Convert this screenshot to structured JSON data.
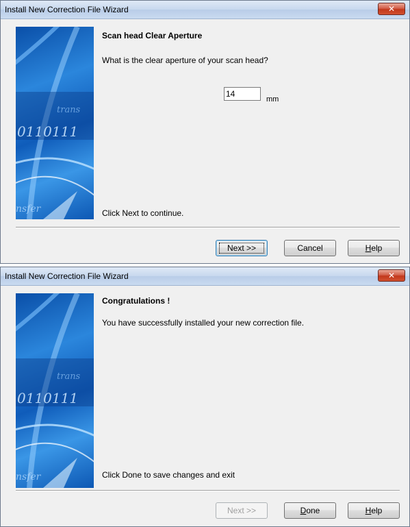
{
  "dialog1": {
    "title": "Install New Correction File Wizard",
    "close_label": "✕",
    "heading": "Scan head Clear Aperture",
    "question": "What is the clear aperture of your scan head?",
    "aperture_value": "14",
    "aperture_unit": "mm",
    "footer_text": "Click Next to continue.",
    "buttons": {
      "next": "Next >>",
      "cancel": "Cancel",
      "help_underlined": "H",
      "help_rest": "elp"
    }
  },
  "dialog2": {
    "title": "Install New Correction File Wizard",
    "close_label": "✕",
    "heading": "Congratulations !",
    "message": "You have successfully installed your new correction file.",
    "footer_text": "Click Done to save changes and exit",
    "buttons": {
      "next": "Next >>",
      "done_underlined": "D",
      "done_rest": "one",
      "help_underlined": "H",
      "help_rest": "elp"
    }
  },
  "colors": {
    "title_gradient_top": "#dfe9f6",
    "close_button": "#c2381c",
    "dialog_background": "#f0f0f0",
    "side_image_blue": "#0f5cba"
  },
  "icons": [
    "close-icon",
    "wizard-side-image"
  ]
}
